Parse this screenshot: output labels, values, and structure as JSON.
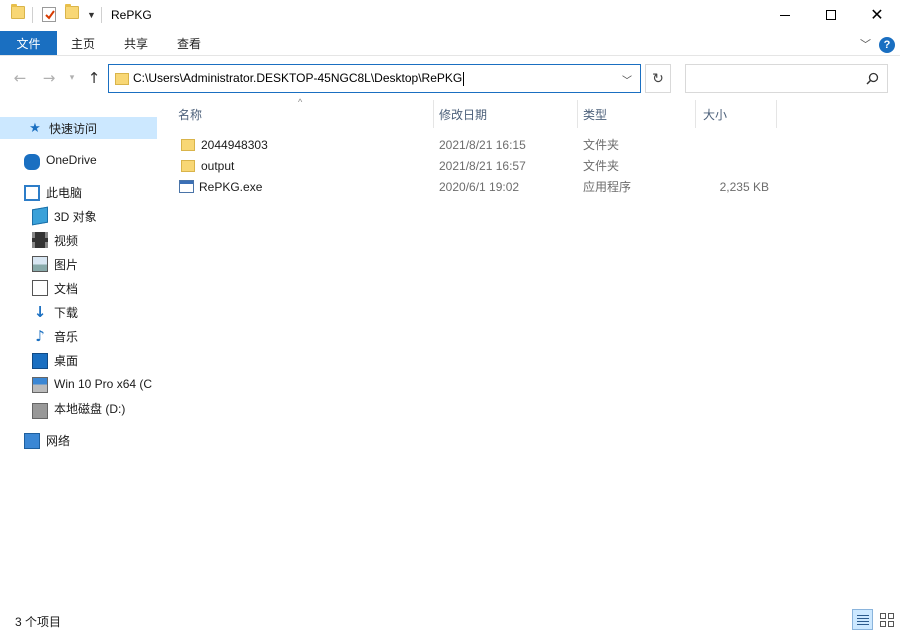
{
  "window": {
    "title": "RePKG",
    "controls": {
      "minimize": "minimize-icon",
      "maximize": "maximize-icon",
      "close": "✕"
    }
  },
  "ribbon": {
    "tabs": [
      {
        "label": "文件",
        "active": true
      },
      {
        "label": "主页"
      },
      {
        "label": "共享"
      },
      {
        "label": "查看"
      }
    ],
    "help": "?"
  },
  "navigation": {
    "address": "C:\\Users\\Administrator.DESKTOP-45NGC8L\\Desktop\\RePKG",
    "search_placeholder": ""
  },
  "sidebar": {
    "items": [
      {
        "label": "快速访问",
        "icon": "star-icon",
        "selected": true
      },
      {
        "label": "OneDrive",
        "icon": "cloud-icon"
      },
      {
        "label": "此电脑",
        "icon": "computer-icon"
      },
      {
        "label": "3D 对象",
        "icon": "cube-icon"
      },
      {
        "label": "视频",
        "icon": "video-icon"
      },
      {
        "label": "图片",
        "icon": "picture-icon"
      },
      {
        "label": "文档",
        "icon": "document-icon"
      },
      {
        "label": "下载",
        "icon": "download-icon"
      },
      {
        "label": "音乐",
        "icon": "music-icon"
      },
      {
        "label": "桌面",
        "icon": "desktop-icon"
      },
      {
        "label": "Win 10 Pro x64 (C",
        "icon": "drive-c-icon"
      },
      {
        "label": "本地磁盘 (D:)",
        "icon": "drive-icon"
      },
      {
        "label": "网络",
        "icon": "network-icon"
      }
    ]
  },
  "file_list": {
    "columns": [
      "名称",
      "修改日期",
      "类型",
      "大小"
    ],
    "rows": [
      {
        "name": "2044948303",
        "date": "2021/8/21 16:15",
        "type": "文件夹",
        "size": "",
        "icon": "folder-icon"
      },
      {
        "name": "output",
        "date": "2021/8/21 16:57",
        "type": "文件夹",
        "size": "",
        "icon": "folder-icon"
      },
      {
        "name": "RePKG.exe",
        "date": "2020/6/1 19:02",
        "type": "应用程序",
        "size": "2,235 KB",
        "icon": "exe-icon"
      }
    ]
  },
  "status": {
    "item_count": "3 个项目"
  },
  "colors": {
    "accent": "#1a6fc1",
    "selection": "#cce8ff",
    "folder": "#f8d775"
  }
}
